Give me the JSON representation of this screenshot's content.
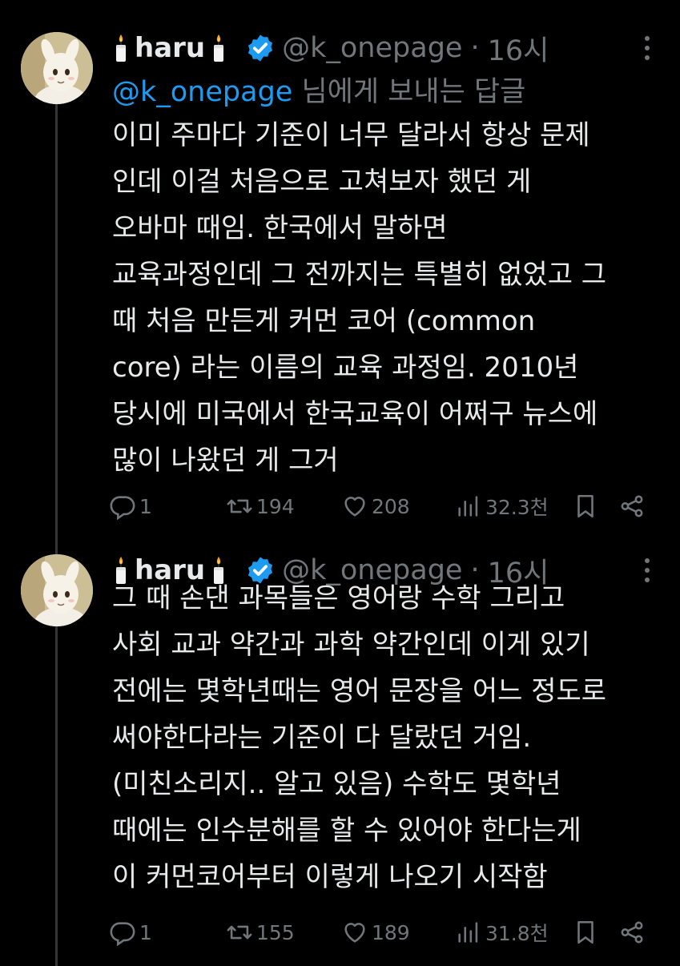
{
  "thread": [
    {
      "author": {
        "display_name": "haru",
        "handle": "@k_onepage",
        "time": "16시",
        "separator": "·",
        "verified": true
      },
      "reply_to": {
        "mention": "@k_onepage",
        "suffix": " 님에게 보내는 답글"
      },
      "text_lines": [
        "이미 주마다 기준이 너무 달라서 항상 문제",
        "인데 이걸 처음으로 고쳐보자 했던 게",
        "오바마 때임. 한국에서 말하면",
        "교육과정인데 그 전까지는 특별히 없었고 그",
        "때 처음 만든게 커먼 코어 (common",
        "core) 라는 이름의 교육 과정임. 2010년",
        "당시에 미국에서 한국교육이 어쩌구 뉴스에",
        "많이 나왔던 게 그거"
      ],
      "stats": {
        "replies": "1",
        "retweets": "194",
        "likes": "208",
        "views": "32.3천"
      }
    },
    {
      "author": {
        "display_name": "haru",
        "handle": "@k_onepage",
        "time": "16시",
        "separator": "·",
        "verified": true
      },
      "text_lines": [
        "그 때 손댄 과목들은 영어랑 수학 그리고",
        "사회 교과 약간과 과학 약간인데 이게 있기",
        "전에는 몇학년때는 영어 문장을 어느 정도로",
        "써야한다라는 기준이 다 달랐던 거임.",
        "(미친소리지.. 알고 있음) 수학도 몇학년",
        "때에는 인수분해를 할 수 있어야 한다는게",
        "이 커먼코어부터 이렇게 나오기 시작함"
      ],
      "stats": {
        "replies": "1",
        "retweets": "155",
        "likes": "189",
        "views": "31.8천"
      }
    }
  ],
  "colors": {
    "background": "#000000",
    "text": "#e7e9ea",
    "secondary": "#71767b",
    "accent": "#1d9bf0",
    "thread_line": "#333639"
  },
  "icons": {
    "verified": "verified-badge-icon",
    "more": "more-icon",
    "reply": "reply-icon",
    "retweet": "retweet-icon",
    "like": "heart-icon",
    "views": "views-icon",
    "bookmark": "bookmark-icon",
    "share": "share-icon",
    "candle": "candle-emoji-icon"
  }
}
